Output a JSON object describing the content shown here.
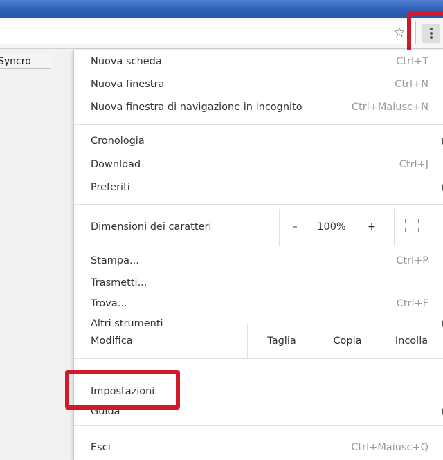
{
  "bookmarks": {
    "item_label": "Syncro"
  },
  "menu": {
    "group1": [
      {
        "label": "Nuova scheda",
        "shortcut": "Ctrl+T"
      },
      {
        "label": "Nuova finestra",
        "shortcut": "Ctrl+N"
      },
      {
        "label": "Nuova finestra di navigazione in incognito",
        "shortcut": "Ctrl+Maiusc+N"
      }
    ],
    "group2": [
      {
        "label": "Cronologia"
      },
      {
        "label": "Download",
        "shortcut": "Ctrl+J"
      },
      {
        "label": "Preferiti"
      }
    ],
    "zoom": {
      "label": "Dimensioni dei caratteri",
      "minus": "–",
      "value": "100%",
      "plus": "+"
    },
    "group3": [
      {
        "label": "Stampa...",
        "shortcut": "Ctrl+P"
      },
      {
        "label": "Trasmetti..."
      },
      {
        "label": "Trova...",
        "shortcut": "Ctrl+F"
      },
      {
        "label": "Altri strumenti"
      }
    ],
    "edit": {
      "label": "Modifica",
      "cut": "Taglia",
      "copy": "Copia",
      "paste": "Incolla"
    },
    "group4": [
      {
        "label": "Impostazioni"
      },
      {
        "label": "Guida"
      }
    ],
    "exit": {
      "label": "Esci",
      "shortcut": "Ctrl+Maiusc+Q"
    }
  },
  "colors": {
    "highlight": "#d2192a",
    "titlebar": "#2e5fb8"
  }
}
